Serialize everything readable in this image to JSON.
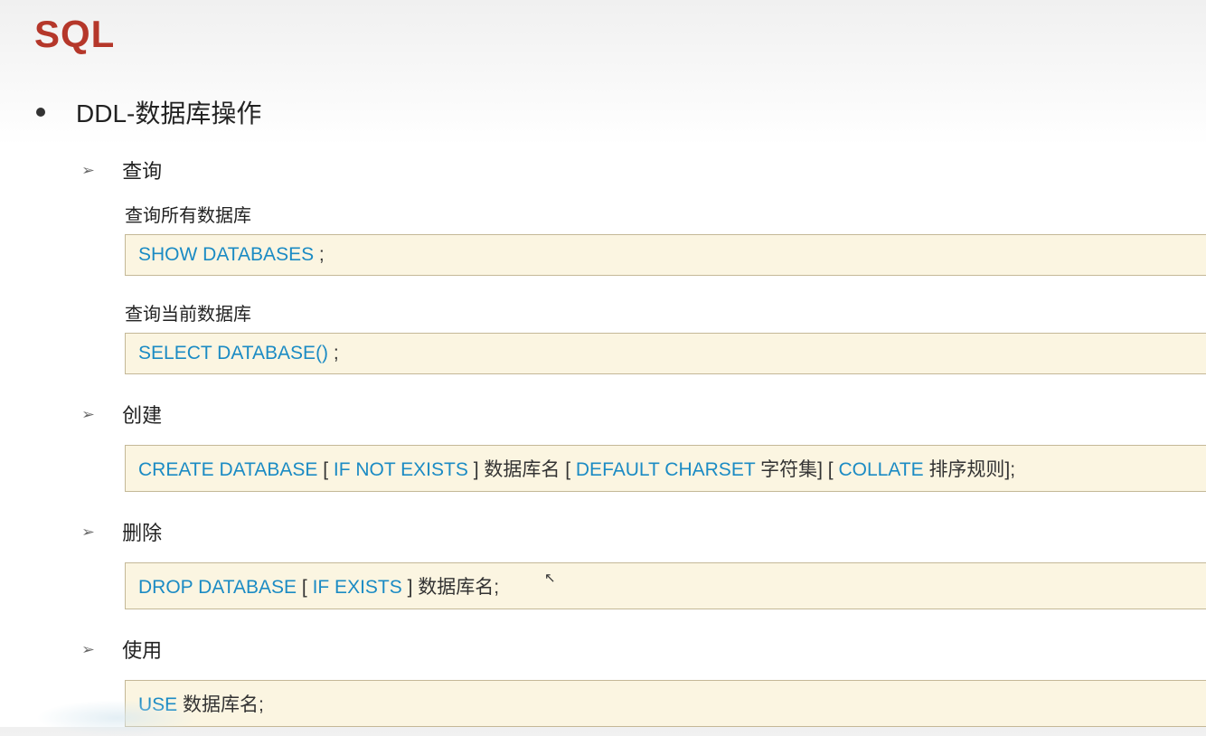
{
  "title": "SQL",
  "section": "DDL-数据库操作",
  "subsections": [
    {
      "label": "查询",
      "items": [
        {
          "caption": "查询所有数据库",
          "code": [
            {
              "type": "kw",
              "text": "SHOW DATABASES "
            },
            {
              "type": "plain",
              "text": ";"
            }
          ]
        },
        {
          "caption": "查询当前数据库",
          "code": [
            {
              "type": "kw",
              "text": "SELECT DATABASE() "
            },
            {
              "type": "plain",
              "text": ";"
            }
          ]
        }
      ]
    },
    {
      "label": "创建",
      "items": [
        {
          "caption": "",
          "code": [
            {
              "type": "kw",
              "text": "CREATE DATABASE "
            },
            {
              "type": "plain",
              "text": " [ "
            },
            {
              "type": "kw",
              "text": "IF NOT EXISTS "
            },
            {
              "type": "plain",
              "text": "]  数据库名  [ "
            },
            {
              "type": "kw",
              "text": "DEFAULT CHARSET "
            },
            {
              "type": "plain",
              "text": "字符集]  [ "
            },
            {
              "type": "kw",
              "text": "COLLATE "
            },
            {
              "type": "plain",
              "text": " 排序规则];"
            }
          ]
        }
      ]
    },
    {
      "label": "删除",
      "items": [
        {
          "caption": "",
          "code": [
            {
              "type": "kw",
              "text": "DROP DATABASE "
            },
            {
              "type": "plain",
              "text": "[ "
            },
            {
              "type": "kw",
              "text": "IF EXISTS "
            },
            {
              "type": "plain",
              "text": "] 数据库名;"
            }
          ]
        }
      ]
    },
    {
      "label": "使用",
      "items": [
        {
          "caption": "",
          "code": [
            {
              "type": "kw",
              "text": "USE "
            },
            {
              "type": "plain",
              "text": " 数据库名;"
            }
          ]
        }
      ]
    }
  ]
}
